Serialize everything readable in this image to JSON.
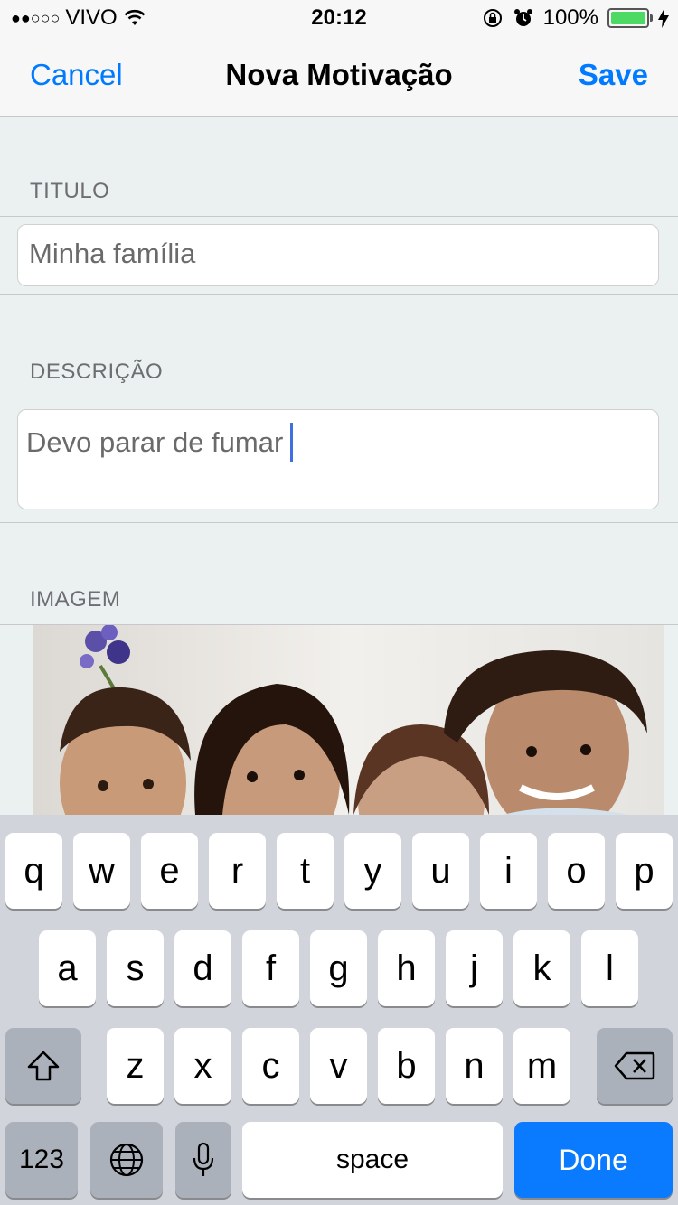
{
  "status_bar": {
    "carrier": "VIVO",
    "signal_dots": "●●○○○",
    "time": "20:12",
    "battery_pct": "100%",
    "battery_level": 1.0
  },
  "nav": {
    "cancel_label": "Cancel",
    "title": "Nova Motivação",
    "save_label": "Save"
  },
  "form": {
    "title_section": "TITULO",
    "title_value": "Minha família",
    "description_section": "DESCRIÇÃO",
    "description_value": "Devo parar de fumar",
    "image_section": "IMAGEM"
  },
  "keyboard": {
    "row1": [
      "q",
      "w",
      "e",
      "r",
      "t",
      "y",
      "u",
      "i",
      "o",
      "p"
    ],
    "row2": [
      "a",
      "s",
      "d",
      "f",
      "g",
      "h",
      "j",
      "k",
      "l"
    ],
    "row3": [
      "z",
      "x",
      "c",
      "v",
      "b",
      "n",
      "m"
    ],
    "numbers_label": "123",
    "space_label": "space",
    "done_label": "Done"
  },
  "colors": {
    "accent": "#007aff",
    "background": "#ebf0f0",
    "keyboard_bg": "#d1d5db",
    "caret": "#3f6fe0"
  }
}
